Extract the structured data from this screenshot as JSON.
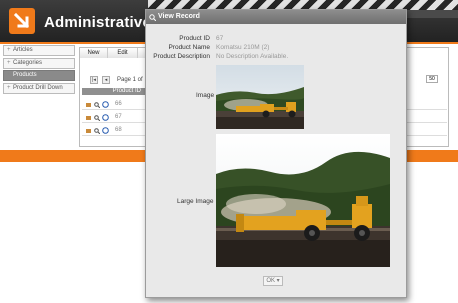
{
  "app": {
    "title": "Administrative",
    "nav": [
      {
        "label": "Articles"
      },
      {
        "label": "Categories"
      },
      {
        "label": "Products"
      },
      {
        "label": "Product Drill Down"
      }
    ],
    "toolbar": {
      "new_label": "New",
      "edit_label": "Edit"
    },
    "pager": {
      "text": "Page 1 of",
      "page_size": "50"
    },
    "grid": {
      "column_header": "Product ID",
      "rows": [
        {
          "id": "66"
        },
        {
          "id": "67"
        },
        {
          "id": "68"
        }
      ]
    }
  },
  "modal": {
    "title": "View Record",
    "fields": {
      "product_id": {
        "label": "Product ID",
        "value": "67"
      },
      "product_name": {
        "label": "Product Name",
        "value": "Komatsu 210M (2)"
      },
      "product_description": {
        "label": "Product Description",
        "value": "No Description Available."
      }
    },
    "image_label": "Image",
    "large_image_label": "Large Image",
    "ok_label": "OK"
  },
  "colors": {
    "accent": "#f07a1a",
    "header": "#2b2b2b",
    "modal_title": "#7d7d7d"
  }
}
